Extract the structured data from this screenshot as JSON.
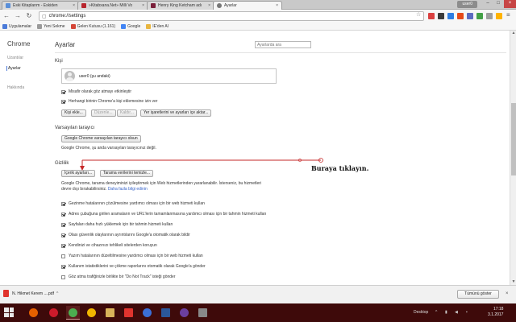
{
  "tabs": [
    {
      "label": "Eski Kitaplarım - Eskiden",
      "active": false,
      "color": "#5a8fd8"
    },
    {
      "label": "»Kitabxana.Net» Milli Vo",
      "active": false,
      "color": "#b8262e"
    },
    {
      "label": "Henry King Ketcham adı",
      "active": false,
      "color": "#7a1f3a"
    },
    {
      "label": "Ayarlar",
      "active": true,
      "color": "#777777"
    }
  ],
  "tab_close_glyph": "×",
  "user_badge": "user0",
  "window_controls": {
    "minimize": "–",
    "maximize": "□",
    "close": "×"
  },
  "toolbar": {
    "url": "chrome://settings",
    "back": "←",
    "forward": "→",
    "reload": "↻"
  },
  "bookmarks": [
    {
      "label": "Uygulamalar",
      "color": "#4b7bd9"
    },
    {
      "label": "Yeni Sekme",
      "color": "#9a9a9a"
    },
    {
      "label": "Gelen Kutusu (1.161)",
      "color": "#d44638"
    },
    {
      "label": "Google",
      "color": "#4285f4"
    },
    {
      "label": "IE'den Al",
      "color": "#e8b640"
    }
  ],
  "sidebar": {
    "title": "Chrome",
    "items": [
      {
        "label": "Uzantılar",
        "active": false
      },
      {
        "label": "Ayarlar",
        "active": true
      },
      {
        "label": "Hakkında",
        "active": false
      }
    ]
  },
  "main": {
    "title": "Ayarlar",
    "search_placeholder": "Ayarlarda ara"
  },
  "people": {
    "title": "Kişi",
    "profile": "user0 (şu andaki)",
    "options": [
      {
        "label": "Misafir olarak göz atmayı etkinleştir",
        "checked": true
      },
      {
        "label": "Herhangi birinin Chrome'a kişi eklemesine izin ver",
        "checked": true
      }
    ],
    "buttons": [
      {
        "label": "Kişi ekle...",
        "disabled": false
      },
      {
        "label": "Düzenle...",
        "disabled": true
      },
      {
        "label": "Kaldır...",
        "disabled": true
      },
      {
        "label": "Yer işaretlerini ve ayarları içe aktar...",
        "disabled": false
      }
    ]
  },
  "default_browser": {
    "title": "Varsayılan tarayıcı",
    "button": "Google Chrome varsayılan tarayıcı olsun",
    "status": "Google Chrome, şu anda varsayılan tarayıcınız değil."
  },
  "privacy": {
    "title": "Gizlilik",
    "content_button": "İçerik ayarları...",
    "clear_button": "Tarama verilerini temizle...",
    "desc_line1": "Google Chrome, tarama deneyiminizi iyileştirmek için Web hizmetlerinden yararlanabilir. İsterseniz, bu hizmetleri",
    "desc_line2": "devre dışı bırakabilirsiniz.",
    "learn_more": "Daha fazla bilgi edinin",
    "options": [
      {
        "label": "Gezinme hatalarının çözülmesine yardımcı olması için bir web hizmeti kullan",
        "checked": true
      },
      {
        "label": "Adres çubuğuna girilen aramaların ve URL'lerin tamamlanmasına yardımcı olması için bir tahmin hizmeti kullan",
        "checked": true
      },
      {
        "label": "Sayfaları daha hızlı yüklemek için bir tahmin hizmeti kullan",
        "checked": true
      },
      {
        "label": "Olası güvenlik olaylarının ayrıntılarını Google'a otomatik olarak bildir",
        "checked": true
      },
      {
        "label": "Kendinizi ve cihazınızı tehlikeli sitelerden koruyun",
        "checked": true
      },
      {
        "label": "Yazım hatalarının düzeltilmesine yardımcı olması için bir web hizmeti kullan",
        "checked": false
      },
      {
        "label": "Kullanım istatistiklerini ve çökme raporlarını otomatik olarak Google'a gönder",
        "checked": true
      },
      {
        "label": "Göz atma trafiğinizle birlikte bir \"Do Not Track\" isteği gönder",
        "checked": false
      }
    ]
  },
  "annotation": {
    "text": "Buraya tıklayın.",
    "color": "#c62828"
  },
  "download_shelf": {
    "file": "N. Hikmet Kerem ....pdf",
    "chevron": "^",
    "show_all": "Tümünü göster",
    "close": "×"
  },
  "taskbar": {
    "desktop_label": "Desktop",
    "time": "17:18",
    "date": "3.1.2017",
    "apps": [
      {
        "name": "firefox",
        "color": "#e66000"
      },
      {
        "name": "opera",
        "color": "#cc1b2b"
      },
      {
        "name": "chrome",
        "color": "#4caf50"
      },
      {
        "name": "chrome-2",
        "color": "#f2b600"
      },
      {
        "name": "files",
        "color": "#d9b35a"
      },
      {
        "name": "acrobat",
        "color": "#e0342e"
      },
      {
        "name": "media",
        "color": "#3b6fd6"
      },
      {
        "name": "word",
        "color": "#2b579a"
      },
      {
        "name": "calibre",
        "color": "#6b3fa0"
      },
      {
        "name": "tool",
        "color": "#888888"
      }
    ]
  }
}
